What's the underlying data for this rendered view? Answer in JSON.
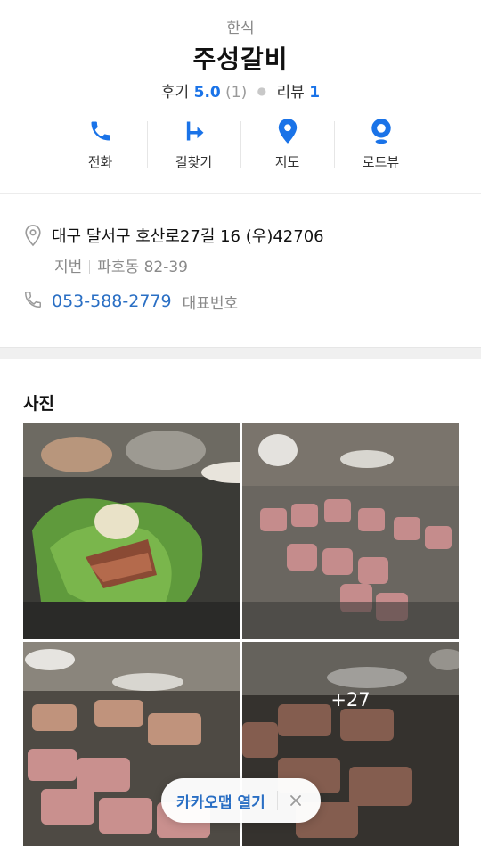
{
  "place": {
    "category": "한식",
    "name": "주성갈비",
    "review_label": "후기",
    "review_score": "5.0",
    "review_count": "(1)",
    "blog_label": "리뷰",
    "blog_count": "1"
  },
  "actions": [
    {
      "label": "전화",
      "icon": "phone-icon"
    },
    {
      "label": "길찾기",
      "icon": "directions-icon"
    },
    {
      "label": "지도",
      "icon": "map-pin-icon"
    },
    {
      "label": "로드뷰",
      "icon": "roadview-icon"
    }
  ],
  "info": {
    "address": "대구 달서구 호산로27길 16 (우)42706",
    "lot_label": "지번",
    "lot_address": "파호동 82-39",
    "phone": "053-588-2779",
    "phone_note": "대표번호"
  },
  "photos": {
    "title": "사진",
    "more_count": "+27"
  },
  "open_app": {
    "label": "카카오맵 열기"
  },
  "colors": {
    "accent": "#1a73e8",
    "link": "#2a6fc4"
  }
}
